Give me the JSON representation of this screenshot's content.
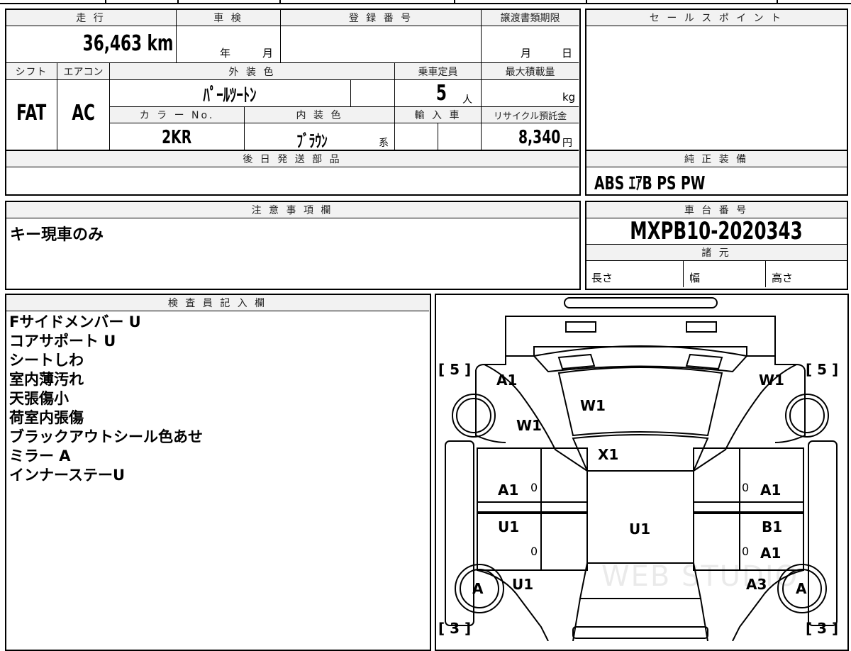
{
  "top_form": {
    "mileage_header": "走 行",
    "mileage_value": "36,463 km",
    "shaken_header": "車 検",
    "shaken_year_unit": "年",
    "shaken_month_unit": "月",
    "reg_number_header": "登 録 番 号",
    "transfer_header": "譲渡書類期限",
    "transfer_month_unit": "月",
    "transfer_day_unit": "日",
    "shift_header": "シフト",
    "shift_value": "FAT",
    "ac_header": "エアコン",
    "ac_value": "AC",
    "exterior_color_header": "外 装 色",
    "exterior_color_value": "ﾊﾟｰﾙﾂｰﾄﾝ",
    "capacity_header": "乗車定員",
    "capacity_value": "5",
    "capacity_unit": "人",
    "max_load_header": "最大積載量",
    "max_load_unit": "kg",
    "color_no_header": "カ ラ ー No.",
    "color_no_value": "2KR",
    "interior_color_header": "内 装 色",
    "interior_color_value": "ﾌﾞﾗｳﾝ",
    "interior_color_suffix": "系",
    "import_header": "輸 入 車",
    "recycle_header": "リサイクル預託金",
    "recycle_value": "8,340",
    "recycle_unit": "円",
    "later_parts_header": "後 日 発 送 部 品"
  },
  "sales_point": {
    "header": "セ ー ル ス ポ イ ン ト"
  },
  "equipment": {
    "header": "純 正 装 備",
    "value": "ABS ｴｱB PS PW"
  },
  "notes": {
    "header": "注 意 事 項 欄",
    "value": "キー現車のみ"
  },
  "chassis": {
    "header": "車 台 番 号",
    "value": "MXPB10-2020343",
    "specs_header": "諸 元",
    "length_label": "長さ",
    "width_label": "幅",
    "height_label": "高さ"
  },
  "inspector": {
    "header": "検 査 員 記 入 欄",
    "lines": [
      "Fサイドメンバー U",
      "コアサポート U",
      "シートしわ",
      "室内薄汚れ",
      "天張傷小",
      "荷室内張傷",
      "ブラックアウトシール色あせ",
      "ミラー A",
      "インナーステーU"
    ]
  },
  "damage_map": {
    "tire_front_left": "[ 5 ]",
    "tire_front_right": "[ 5 ]",
    "tire_rear_left": "[ 3 ]",
    "tire_rear_right": "[ 3 ]",
    "front_left_fender": "A1",
    "front_right_fender": "W1",
    "windshield": "W1",
    "left_a_pillar": "W1",
    "roof_front": "X1",
    "left_front_door": "A1",
    "left_front_door_mark": "0",
    "right_front_door_mark": "0",
    "right_front_door": "A1",
    "left_rear_door": "U1",
    "floor": "U1",
    "right_rear_door": "B1",
    "left_rear_door_mark": "0",
    "right_rear_door_mark": "0",
    "right_rear_door_2": "A1",
    "left_quarter": "U1",
    "right_quarter": "A3",
    "left_rear_wheel": "A",
    "right_rear_wheel": "A",
    "watermark": "WEB STUDIO"
  }
}
